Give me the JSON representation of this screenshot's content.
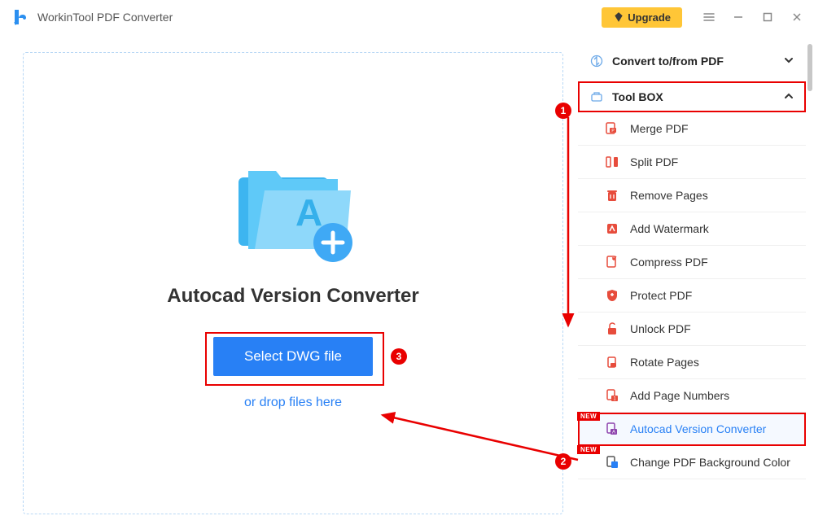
{
  "app": {
    "title": "WorkinTool PDF Converter",
    "upgrade_label": "Upgrade"
  },
  "main": {
    "heading": "Autocad Version Converter",
    "select_button": "Select DWG file",
    "drop_hint": "or drop files here"
  },
  "sidebar": {
    "sections": [
      {
        "label": "Convert to/from PDF",
        "expanded": false
      },
      {
        "label": "Tool BOX",
        "expanded": true
      }
    ],
    "tools": [
      {
        "label": "Merge PDF",
        "new": false
      },
      {
        "label": "Split PDF",
        "new": false
      },
      {
        "label": "Remove Pages",
        "new": false
      },
      {
        "label": "Add Watermark",
        "new": false
      },
      {
        "label": "Compress PDF",
        "new": false
      },
      {
        "label": "Protect PDF",
        "new": false
      },
      {
        "label": "Unlock PDF",
        "new": false
      },
      {
        "label": "Rotate Pages",
        "new": false
      },
      {
        "label": "Add Page Numbers",
        "new": false
      },
      {
        "label": "Autocad Version Converter",
        "new": true,
        "active": true
      },
      {
        "label": "Change PDF Background Color",
        "new": true
      }
    ]
  },
  "annotations": {
    "badge1": "1",
    "badge2": "2",
    "badge3": "3",
    "new_label": "NEW"
  }
}
